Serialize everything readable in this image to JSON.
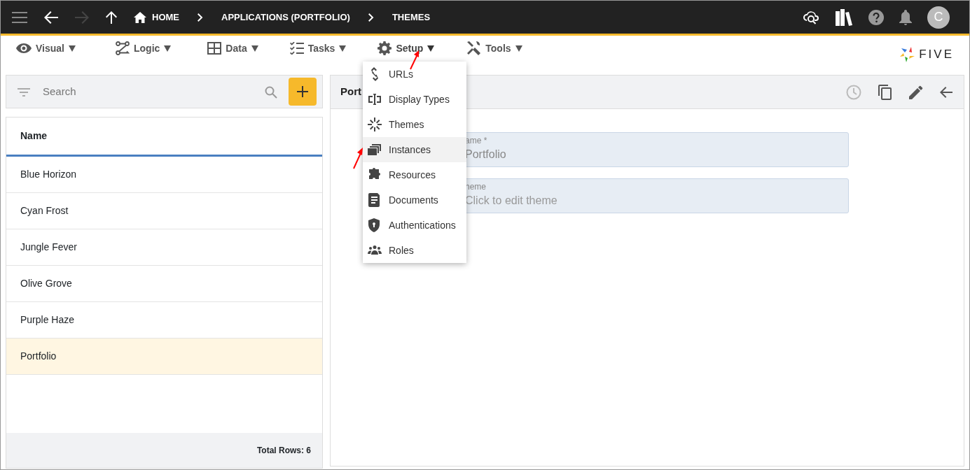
{
  "topbar": {
    "breadcrumbs": [
      {
        "label": "HOME",
        "kind": "home"
      },
      {
        "label": "APPLICATIONS (PORTFOLIO)",
        "kind": "plain"
      },
      {
        "label": "THEMES",
        "kind": "plain"
      }
    ],
    "avatar": "C"
  },
  "toolbar": {
    "menus": [
      {
        "label": "Visual",
        "open": false
      },
      {
        "label": "Logic",
        "open": false
      },
      {
        "label": "Data",
        "open": false
      },
      {
        "label": "Tasks",
        "open": false
      },
      {
        "label": "Setup",
        "open": true
      },
      {
        "label": "Tools",
        "open": false
      }
    ],
    "logo": "FIVE"
  },
  "search": {
    "placeholder": "Search"
  },
  "list": {
    "column": "Name",
    "rows": [
      {
        "name": "Blue Horizon",
        "selected": false
      },
      {
        "name": "Cyan Frost",
        "selected": false
      },
      {
        "name": "Jungle Fever",
        "selected": false
      },
      {
        "name": "Olive Grove",
        "selected": false
      },
      {
        "name": "Purple Haze",
        "selected": false
      },
      {
        "name": "Portfolio",
        "selected": true
      }
    ],
    "footer": "Total Rows: 6"
  },
  "form": {
    "title": "Port",
    "fields": [
      {
        "label": "ame *",
        "value": "Portfolio"
      },
      {
        "label": "heme",
        "placeholder": "Click to edit theme"
      }
    ]
  },
  "setup_menu": {
    "items": [
      {
        "label": "URLs",
        "selected": false
      },
      {
        "label": "Display Types",
        "selected": false
      },
      {
        "label": "Themes",
        "selected": false
      },
      {
        "label": "Instances",
        "selected": true
      },
      {
        "label": "Resources",
        "selected": false
      },
      {
        "label": "Documents",
        "selected": false
      },
      {
        "label": "Authentications",
        "selected": false
      },
      {
        "label": "Roles",
        "selected": false
      }
    ]
  }
}
